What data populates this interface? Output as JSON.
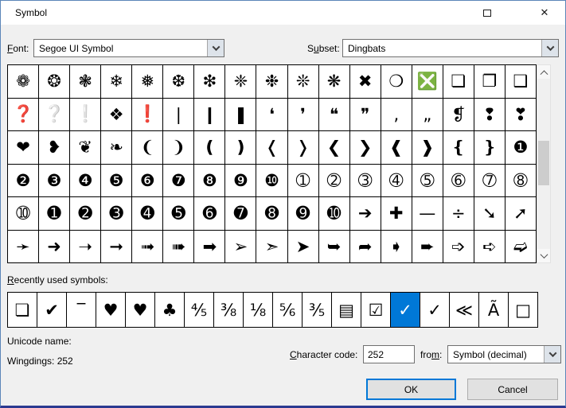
{
  "window": {
    "title": "Symbol"
  },
  "icons": {
    "close": "✕"
  },
  "toolbar": {
    "font_label_parts": {
      "pre": "",
      "key": "F",
      "post": "ont:"
    },
    "font_value": "Segoe UI Symbol",
    "subset_label_parts": {
      "pre": "S",
      "key": "u",
      "post": "bset:"
    },
    "subset_value": "Dingbats"
  },
  "grid": {
    "rows": [
      [
        "❁",
        "❂",
        "❃",
        "❄",
        "❅",
        "❆",
        "❇",
        "❈",
        "❉",
        "❊",
        "❋",
        "✖",
        "❍",
        "❎",
        "❏",
        "❐",
        "❑"
      ],
      [
        "❓",
        "❔",
        "❕",
        "❖",
        "❗",
        "❘",
        "❙",
        "❚",
        "❛",
        "❜",
        "❝",
        "❞",
        "‚",
        "„",
        "❡",
        "❢",
        "❣"
      ],
      [
        "❤",
        "❥",
        "❦",
        "❧",
        "❨",
        "❩",
        "❪",
        "❫",
        "❬",
        "❭",
        "❮",
        "❯",
        "❰",
        "❱",
        "❴",
        "❵",
        "❶"
      ],
      [
        "❷",
        "❸",
        "❹",
        "❺",
        "❻",
        "❼",
        "❽",
        "❾",
        "❿",
        "➀",
        "➁",
        "➂",
        "➃",
        "➄",
        "➅",
        "➆",
        "➇"
      ],
      [
        "➉",
        "➊",
        "➋",
        "➌",
        "➍",
        "➎",
        "➏",
        "➐",
        "➑",
        "➒",
        "➓",
        "➔",
        "✚",
        "—",
        "÷",
        "➘",
        "➚"
      ],
      [
        "➛",
        "➜",
        "➝",
        "➞",
        "➟",
        "➠",
        "➡",
        "➢",
        "➣",
        "➤",
        "➥",
        "➦",
        "➧",
        "➨",
        "➩",
        "➪",
        "➫"
      ]
    ]
  },
  "recent": {
    "label_parts": {
      "pre": "",
      "key": "R",
      "post": "ecently used symbols:"
    },
    "symbols": [
      "❏",
      "✔",
      "‾",
      "♥",
      "♥",
      "♣",
      "⅘",
      "⅜",
      "⅛",
      "⅚",
      "⅗",
      "▤",
      "☑",
      "✓",
      "✓",
      "≪",
      "Ã",
      "□"
    ],
    "selected_index": 13
  },
  "details": {
    "unicode_name_label": "Unicode name:",
    "unicode_name_value": "Wingdings: 252",
    "char_code_label_parts": {
      "pre": "",
      "key": "C",
      "post": "haracter code:"
    },
    "char_code_value": "252",
    "from_label_parts": {
      "pre": "fro",
      "key": "m",
      "post": ":"
    },
    "from_value": "Symbol (decimal)"
  },
  "actions": {
    "ok": "OK",
    "cancel": "Cancel"
  },
  "colors": {
    "accent": "#0078d7",
    "selection_bg": "#0078d7",
    "grid_border": "#000000"
  }
}
